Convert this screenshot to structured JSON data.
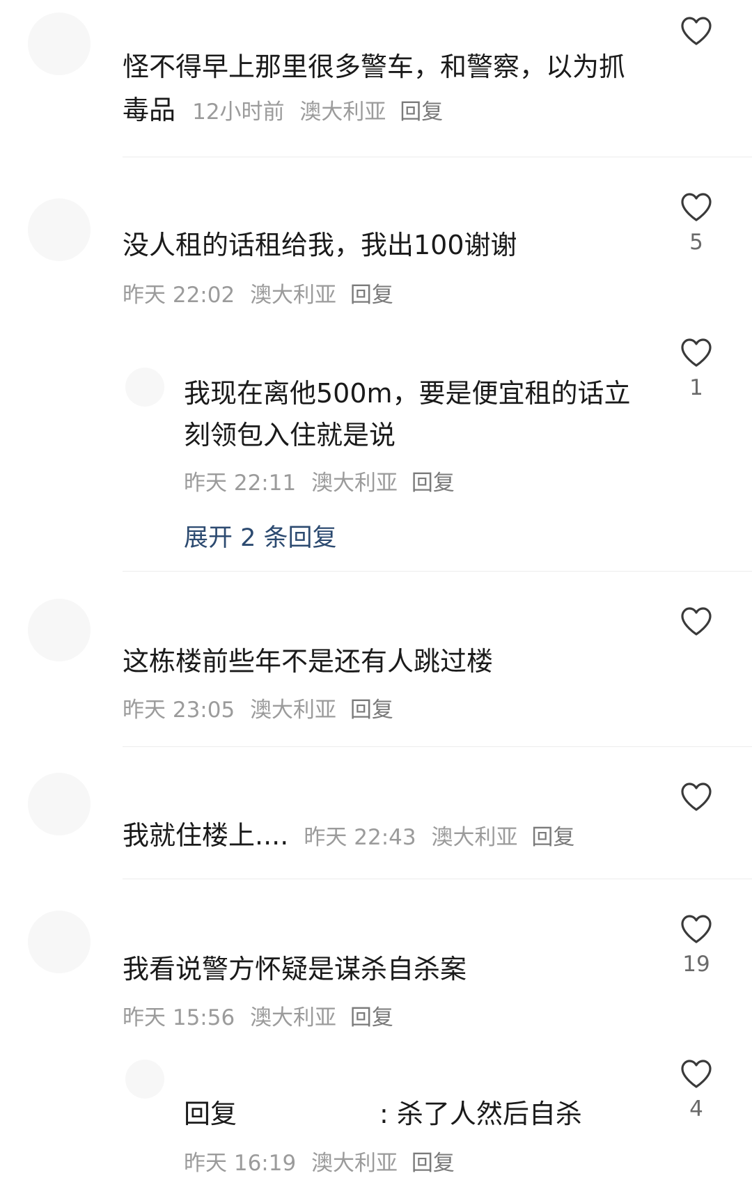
{
  "comments": [
    {
      "text_line1": "怪不得早上那里很多警车，和警察，以为抓",
      "text_line2": "毒品",
      "time": "12小时前",
      "location": "澳大利亚",
      "reply": "回复",
      "likes": ""
    },
    {
      "text": "没人租的话租给我，我出100谢谢",
      "time": "昨天 22:02",
      "location": "澳大利亚",
      "reply": "回复",
      "likes": "5"
    },
    {
      "text_line1": "我现在离他500m，要是便宜租的话立",
      "text_line2": "刻领包入住就是说",
      "time": "昨天 22:11",
      "location": "澳大利亚",
      "reply": "回复",
      "likes": "1",
      "expand": "展开 2 条回复"
    },
    {
      "text": "这栋楼前些年不是还有人跳过楼",
      "time": "昨天 23:05",
      "location": "澳大利亚",
      "reply": "回复",
      "likes": ""
    },
    {
      "text": "我就住楼上....",
      "time": "昨天 22:43",
      "location": "澳大利亚",
      "reply": "回复",
      "likes": ""
    },
    {
      "text": "我看说警方怀疑是谋杀自杀案",
      "time": "昨天 15:56",
      "location": "澳大利亚",
      "reply": "回复",
      "likes": "19"
    },
    {
      "reply_prefix": "回复",
      "text": ": 杀了人然后自杀",
      "time": "昨天 16:19",
      "location": "澳大利亚",
      "reply": "回复",
      "likes": "4"
    }
  ],
  "icons": {
    "like": "heart-outline-icon"
  },
  "colors": {
    "text": "#1a1a1a",
    "meta": "#9b9b9b",
    "link": "#2c4a70",
    "divider": "#ececec"
  }
}
